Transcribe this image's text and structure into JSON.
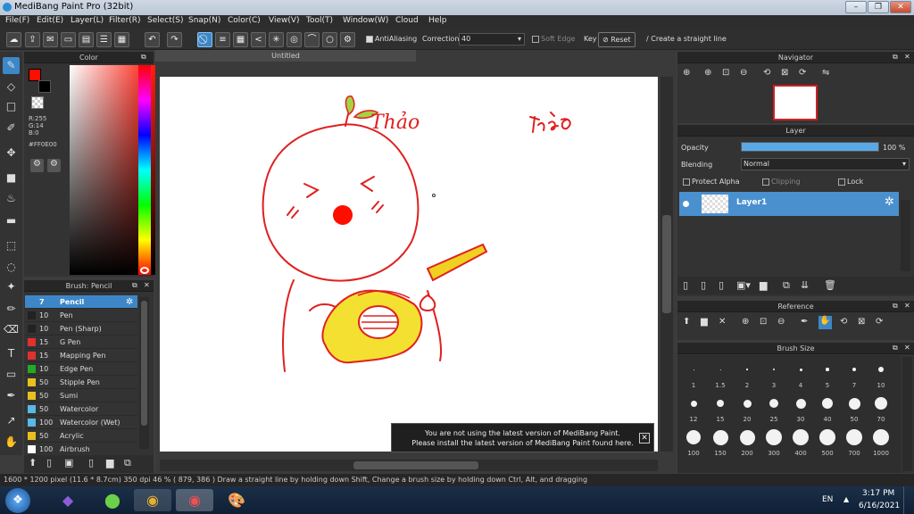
{
  "app": {
    "title": "MediBang Paint Pro (32bit)",
    "window_buttons": [
      "–",
      "❐",
      "✕"
    ]
  },
  "menu": [
    "File(F)",
    "Edit(E)",
    "Layer(L)",
    "Filter(R)",
    "Select(S)",
    "Snap(N)",
    "Color(C)",
    "View(V)",
    "Tool(T)",
    "Window(W)",
    "Cloud",
    "Help"
  ],
  "toolbar": {
    "antialiasing_label": "AntiAliasing",
    "correction_label": "Correction",
    "correction_value": "40",
    "soft_edge_label": "Soft Edge",
    "key_label": "Key",
    "reset_label": "Reset",
    "straight_line_label": "Create a straight line"
  },
  "color_panel": {
    "title": "Color",
    "r": "R:255",
    "g": "G:14",
    "b": "B:0",
    "hex": "#FF0E00",
    "primary": "#FF0E00"
  },
  "document": {
    "tab_title": "Untitled",
    "signature": "Thảo"
  },
  "brush_panel": {
    "title": "Brush: Pencil",
    "brushes": [
      {
        "size": "7",
        "name": "Pencil",
        "color": "#3d87c9"
      },
      {
        "size": "10",
        "name": "Pen",
        "color": "#222222"
      },
      {
        "size": "10",
        "name": "Pen (Sharp)",
        "color": "#222222"
      },
      {
        "size": "15",
        "name": "G Pen",
        "color": "#e03030"
      },
      {
        "size": "15",
        "name": "Mapping Pen",
        "color": "#e03030"
      },
      {
        "size": "10",
        "name": "Edge Pen",
        "color": "#22aa22"
      },
      {
        "size": "50",
        "name": "Stipple Pen",
        "color": "#e8c020"
      },
      {
        "size": "50",
        "name": "Sumi",
        "color": "#e8c020"
      },
      {
        "size": "50",
        "name": "Watercolor",
        "color": "#58b8e8"
      },
      {
        "size": "100",
        "name": "Watercolor (Wet)",
        "color": "#58b8e8"
      },
      {
        "size": "50",
        "name": "Acrylic",
        "color": "#e8c020"
      },
      {
        "size": "100",
        "name": "Airbrush",
        "color": "#ffffff"
      }
    ]
  },
  "navigator": {
    "title": "Navigator"
  },
  "layer_panel": {
    "title": "Layer",
    "opacity_label": "Opacity",
    "opacity_value": "100 %",
    "opacity_percent": 100,
    "blending_label": "Blending",
    "blending_value": "Normal",
    "protect_alpha": "Protect Alpha",
    "clipping": "Clipping",
    "lock": "Lock",
    "layer_name": "Layer1"
  },
  "reference_panel": {
    "title": "Reference"
  },
  "brush_size_panel": {
    "title": "Brush Size",
    "sizes": [
      "1",
      "1.5",
      "2",
      "3",
      "4",
      "5",
      "7",
      "10",
      "12",
      "15",
      "20",
      "25",
      "30",
      "40",
      "50",
      "70",
      "100",
      "150",
      "200",
      "300",
      "400",
      "500",
      "700",
      "1000"
    ]
  },
  "notice": {
    "line1": "You are not using the latest version of MediBang Paint.",
    "line2": "Please install the latest version of MediBang Paint found here."
  },
  "status": {
    "text": "1600 * 1200 pixel  (11.6 * 8.7cm)  350 dpi  46 %  ( 879, 386 )  Draw a straight line by holding down Shift, Change a brush size by holding down Ctrl, Alt, and dragging"
  },
  "taskbar": {
    "lang": "EN",
    "time": "3:17 PM",
    "date": "6/16/2021"
  }
}
